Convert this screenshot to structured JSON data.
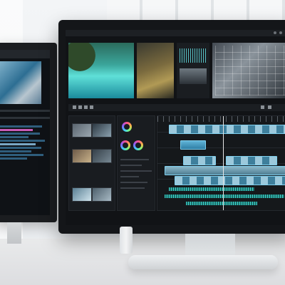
{
  "scene": {
    "description_visible_text": "",
    "accent_colors": {
      "timeline_clip": "#5fb3d6",
      "audio_wave": "#3ed0c8",
      "color_wheel_ring": "#ff4d8d"
    },
    "icons": [
      "play-icon",
      "pause-icon",
      "step-back-icon",
      "step-forward-icon",
      "loop-icon"
    ]
  }
}
